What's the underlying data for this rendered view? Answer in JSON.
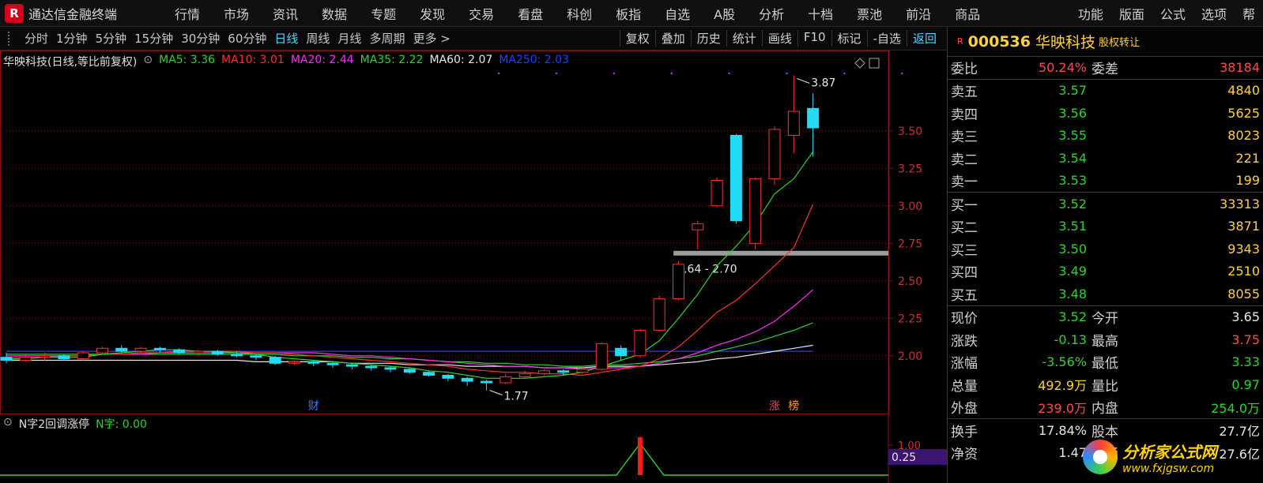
{
  "app": {
    "name": "通达信金融终端",
    "logo": "R"
  },
  "menu": [
    "行情",
    "市场",
    "资讯",
    "数据",
    "专题",
    "发现",
    "交易",
    "看盘",
    "科创",
    "板指",
    "自选",
    "A股",
    "分析",
    "十档",
    "票池",
    "前沿",
    "商品"
  ],
  "menu_right": [
    "功能",
    "版面",
    "公式",
    "选项",
    "帮"
  ],
  "periods": [
    {
      "label": "分时",
      "active": false
    },
    {
      "label": "1分钟",
      "active": false
    },
    {
      "label": "5分钟",
      "active": false
    },
    {
      "label": "15分钟",
      "active": false
    },
    {
      "label": "30分钟",
      "active": false
    },
    {
      "label": "60分钟",
      "active": false
    },
    {
      "label": "日线",
      "active": true
    },
    {
      "label": "周线",
      "active": false
    },
    {
      "label": "月线",
      "active": false
    },
    {
      "label": "多周期",
      "active": false
    },
    {
      "label": "更多 >",
      "active": false
    }
  ],
  "tools": [
    "复权",
    "叠加",
    "历史",
    "统计",
    "画线",
    "F10",
    "标记",
    "-自选",
    "返回"
  ],
  "chart_info": {
    "title": "华映科技(日线,等比前复权)",
    "ma": [
      {
        "label": "MA5: 3.36",
        "color": "#2bd62b"
      },
      {
        "label": "MA10: 3.01",
        "color": "#ff3030"
      },
      {
        "label": "MA20: 2.44",
        "color": "#ff2cff"
      },
      {
        "label": "MA35: 2.22",
        "color": "#2bd62b"
      },
      {
        "label": "MA60: 2.07",
        "color": "#e8e8e8"
      },
      {
        "label": "MA250: 2.03",
        "color": "#2040ff"
      }
    ]
  },
  "chart_data": {
    "type": "candlestick",
    "y_ticks": [
      "3.50",
      "3.25",
      "3.00",
      "2.75",
      "2.50",
      "2.25",
      "2.00"
    ],
    "ylim": [
      1.72,
      3.92
    ],
    "high_label": "3.87",
    "low_label": "1.77",
    "zone_label": "2.64 - 2.70",
    "zone": [
      2.67,
      2.7
    ],
    "markers": [
      {
        "text": "财",
        "color": "#3b7bff"
      },
      {
        "text": "涨",
        "color": "#ff4040"
      },
      {
        "text": "榜",
        "color": "#ff9a30"
      }
    ],
    "candles": [
      [
        1.99,
        1.97,
        2.02,
        1.95
      ],
      [
        1.97,
        1.99,
        2.01,
        1.96
      ],
      [
        1.99,
        2.0,
        2.02,
        1.97
      ],
      [
        2.0,
        1.98,
        2.01,
        1.97
      ],
      [
        1.98,
        2.02,
        2.03,
        1.97
      ],
      [
        2.02,
        2.05,
        2.06,
        2.01
      ],
      [
        2.05,
        2.03,
        2.07,
        2.02
      ],
      [
        2.03,
        2.05,
        2.06,
        2.02
      ],
      [
        2.05,
        2.04,
        2.06,
        2.02
      ],
      [
        2.04,
        2.02,
        2.05,
        2.01
      ],
      [
        2.02,
        2.03,
        2.04,
        2.0
      ],
      [
        2.03,
        2.01,
        2.04,
        2.0
      ],
      [
        2.01,
        2.0,
        2.03,
        1.99
      ],
      [
        2.0,
        1.99,
        2.01,
        1.97
      ],
      [
        1.99,
        1.95,
        2.0,
        1.94
      ],
      [
        1.95,
        1.96,
        1.97,
        1.94
      ],
      [
        1.96,
        1.95,
        1.97,
        1.93
      ],
      [
        1.95,
        1.94,
        1.96,
        1.92
      ],
      [
        1.94,
        1.93,
        1.95,
        1.91
      ],
      [
        1.93,
        1.92,
        1.94,
        1.9
      ],
      [
        1.92,
        1.91,
        1.93,
        1.89
      ],
      [
        1.91,
        1.89,
        1.92,
        1.88
      ],
      [
        1.89,
        1.87,
        1.9,
        1.86
      ],
      [
        1.87,
        1.85,
        1.88,
        1.83
      ],
      [
        1.85,
        1.83,
        1.86,
        1.8
      ],
      [
        1.83,
        1.82,
        1.84,
        1.77
      ],
      [
        1.82,
        1.86,
        1.88,
        1.81
      ],
      [
        1.86,
        1.88,
        1.9,
        1.85
      ],
      [
        1.88,
        1.9,
        1.91,
        1.87
      ],
      [
        1.9,
        1.89,
        1.91,
        1.87
      ],
      [
        1.89,
        1.91,
        1.93,
        1.88
      ],
      [
        1.91,
        2.08,
        2.09,
        1.9
      ],
      [
        2.05,
        2.0,
        2.07,
        1.97
      ],
      [
        2.0,
        2.17,
        2.18,
        1.99
      ],
      [
        2.17,
        2.38,
        2.4,
        2.16
      ],
      [
        2.38,
        2.61,
        2.63,
        2.37
      ],
      [
        2.84,
        2.88,
        2.9,
        2.71
      ],
      [
        3.0,
        3.17,
        3.19,
        2.99
      ],
      [
        3.47,
        2.9,
        3.48,
        2.88
      ],
      [
        2.75,
        3.18,
        3.19,
        2.71
      ],
      [
        3.18,
        3.51,
        3.53,
        3.14
      ],
      [
        3.47,
        3.63,
        3.87,
        3.35
      ],
      [
        3.65,
        3.52,
        3.75,
        3.33
      ]
    ],
    "ma5": [
      1.98,
      1.98,
      1.99,
      1.99,
      1.99,
      2.01,
      2.02,
      2.03,
      2.04,
      2.04,
      2.03,
      2.03,
      2.02,
      2.01,
      1.99,
      1.98,
      1.97,
      1.96,
      1.95,
      1.94,
      1.93,
      1.92,
      1.9,
      1.89,
      1.87,
      1.85,
      1.85,
      1.85,
      1.86,
      1.87,
      1.89,
      1.93,
      1.97,
      2.01,
      2.1,
      2.25,
      2.41,
      2.6,
      2.73,
      2.88,
      3.08,
      3.18,
      3.36
    ],
    "ma10": [
      1.99,
      1.99,
      1.99,
      2.0,
      2.0,
      2.01,
      2.01,
      2.02,
      2.02,
      2.03,
      2.03,
      2.03,
      2.03,
      2.02,
      2.02,
      2.01,
      2.0,
      1.99,
      1.98,
      1.97,
      1.96,
      1.95,
      1.94,
      1.93,
      1.91,
      1.9,
      1.89,
      1.89,
      1.88,
      1.88,
      1.87,
      1.89,
      1.91,
      1.93,
      1.98,
      2.06,
      2.17,
      2.29,
      2.37,
      2.48,
      2.6,
      2.72,
      3.01
    ],
    "ma20": [
      2.0,
      2.0,
      2.0,
      2.0,
      2.0,
      2.01,
      2.01,
      2.01,
      2.02,
      2.02,
      2.02,
      2.02,
      2.02,
      2.02,
      2.02,
      2.02,
      2.02,
      2.01,
      2.0,
      2.0,
      1.99,
      1.98,
      1.97,
      1.96,
      1.95,
      1.94,
      1.93,
      1.93,
      1.92,
      1.92,
      1.91,
      1.92,
      1.92,
      1.93,
      1.95,
      1.98,
      2.02,
      2.07,
      2.11,
      2.16,
      2.23,
      2.33,
      2.44
    ],
    "ma35": [
      2.01,
      2.01,
      2.01,
      2.01,
      2.01,
      2.01,
      2.01,
      2.01,
      2.01,
      2.01,
      2.01,
      2.01,
      2.01,
      2.01,
      2.01,
      2.0,
      2.0,
      2.0,
      1.99,
      1.99,
      1.98,
      1.98,
      1.97,
      1.96,
      1.96,
      1.95,
      1.95,
      1.94,
      1.94,
      1.93,
      1.93,
      1.94,
      1.94,
      1.95,
      1.96,
      1.98,
      2.0,
      2.03,
      2.06,
      2.09,
      2.13,
      2.17,
      2.22
    ],
    "ma60": [
      1.97,
      1.97,
      1.97,
      1.97,
      1.97,
      1.97,
      1.97,
      1.97,
      1.97,
      1.97,
      1.97,
      1.97,
      1.97,
      1.96,
      1.96,
      1.96,
      1.96,
      1.96,
      1.95,
      1.95,
      1.95,
      1.94,
      1.94,
      1.94,
      1.93,
      1.93,
      1.93,
      1.93,
      1.92,
      1.92,
      1.92,
      1.93,
      1.93,
      1.93,
      1.94,
      1.95,
      1.96,
      1.98,
      1.99,
      2.01,
      2.03,
      2.05,
      2.07
    ],
    "ma250": [
      2.03,
      2.03,
      2.03,
      2.03,
      2.03,
      2.03,
      2.03,
      2.03,
      2.03,
      2.03,
      2.03,
      2.03,
      2.03,
      2.03,
      2.03,
      2.03,
      2.03,
      2.03,
      2.03,
      2.03,
      2.03,
      2.03,
      2.03,
      2.03,
      2.03,
      2.03,
      2.03,
      2.03,
      2.03,
      2.03,
      2.03,
      2.03,
      2.03,
      2.03,
      2.03,
      2.03,
      2.03,
      2.03,
      2.03,
      2.03,
      2.03,
      2.03,
      2.03
    ],
    "indicator": {
      "name": "N字2回调涨停",
      "line_label": "N字: 0.00",
      "y_tick": "1.00",
      "current_tag": "0.25",
      "signal_index": 33
    }
  },
  "stock": {
    "code": "000536",
    "name": "华映科技",
    "note": "股权转让"
  },
  "quotes": {
    "weibi": {
      "label": "委比",
      "value": "50.24%",
      "label2": "委差",
      "value2": "38184"
    },
    "asks": [
      {
        "label": "卖五",
        "price": "3.57",
        "vol": "4840"
      },
      {
        "label": "卖四",
        "price": "3.56",
        "vol": "5625"
      },
      {
        "label": "卖三",
        "price": "3.55",
        "vol": "8023"
      },
      {
        "label": "卖二",
        "price": "3.54",
        "vol": "221"
      },
      {
        "label": "卖一",
        "price": "3.53",
        "vol": "199"
      }
    ],
    "bids": [
      {
        "label": "买一",
        "price": "3.52",
        "vol": "33313"
      },
      {
        "label": "买二",
        "price": "3.51",
        "vol": "3871"
      },
      {
        "label": "买三",
        "price": "3.50",
        "vol": "9343"
      },
      {
        "label": "买四",
        "price": "3.49",
        "vol": "2510"
      },
      {
        "label": "买五",
        "price": "3.48",
        "vol": "8055"
      }
    ],
    "stats": [
      {
        "l1": "现价",
        "v1": "3.52",
        "c1": "green",
        "l2": "今开",
        "v2": "3.65",
        "c2": "white"
      },
      {
        "l1": "涨跌",
        "v1": "-0.13",
        "c1": "green",
        "l2": "最高",
        "v2": "3.75",
        "c2": "red"
      },
      {
        "l1": "涨幅",
        "v1": "-3.56%",
        "c1": "green",
        "l2": "最低",
        "v2": "3.33",
        "c2": "green"
      },
      {
        "l1": "总量",
        "v1": "492.9万",
        "c1": "yellow",
        "l2": "量比",
        "v2": "0.97",
        "c2": "green"
      },
      {
        "l1": "外盘",
        "v1": "239.0万",
        "c1": "red",
        "l2": "内盘",
        "v2": "254.0万",
        "c2": "green"
      }
    ],
    "extra": [
      {
        "l1": "换手",
        "v1": "17.84%",
        "l2": "股本",
        "v2": "27.7亿"
      },
      {
        "l1": "净资",
        "v1": "1.47",
        "l2": "流通",
        "v2": "27.6亿"
      }
    ]
  },
  "watermark": {
    "title": "分析家公式网",
    "url": "www.fxjgsw.com"
  },
  "colors": {
    "up": "#ff3030",
    "down": "#22dcf5",
    "grid": "#8a1010",
    "axis": "#8a1010"
  }
}
